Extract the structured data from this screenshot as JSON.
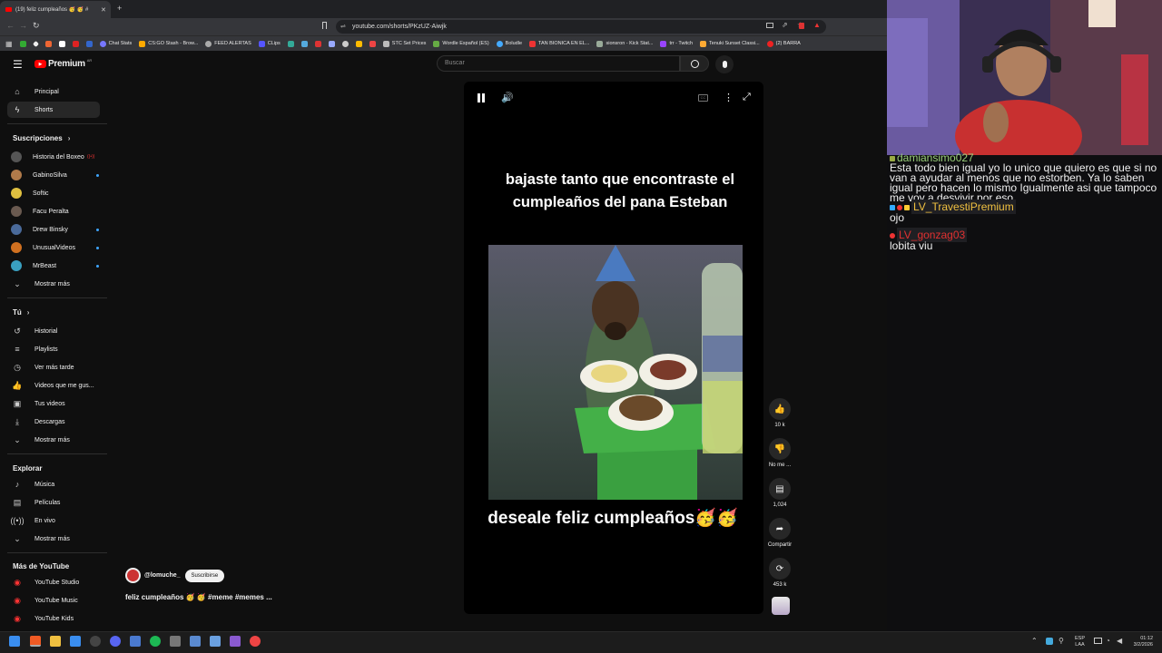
{
  "browser": {
    "tab_title": "(19) feliz cumpleaños 🥳 🥳 #",
    "url": "youtube.com/shorts/PKzUZ-Aiwjk",
    "bookmarks": [
      "Chat Stats",
      "CS:GO Stash - Brow...",
      "FEED ALERTAS",
      "CLips",
      "STC Set Prices",
      "Wordle Español (ES)",
      "Boludle",
      "TAN BIONICA EN EL...",
      "sionsron - Kick Stat...",
      "trr - Twitch",
      "Tenuki Sunset Classi...",
      "(2) BARRA"
    ]
  },
  "youtube": {
    "logo_text": "Premium",
    "logo_region": "AR",
    "search_placeholder": "Buscar",
    "sidebar": {
      "main": [
        {
          "label": "Principal",
          "icon": "home-icon"
        },
        {
          "label": "Shorts",
          "icon": "shorts-icon"
        }
      ],
      "subscriptions_title": "Suscripciones",
      "subscriptions": [
        {
          "label": "Historia del Boxeo",
          "color": "#555"
        },
        {
          "label": "GabinoSilva",
          "color": "#b07a4a"
        },
        {
          "label": "Softic",
          "color": "#e0c040"
        },
        {
          "label": "Facu Peralta",
          "color": "#6a5a50"
        },
        {
          "label": "Drew Binsky",
          "color": "#4a6a9a"
        },
        {
          "label": "UnusualVideos",
          "color": "#d07020"
        },
        {
          "label": "MrBeast",
          "color": "#3aa0c0"
        }
      ],
      "show_more": "Mostrar más",
      "you_title": "Tú",
      "you": [
        {
          "label": "Historial",
          "icon": "history-icon"
        },
        {
          "label": "Playlists",
          "icon": "playlist-icon"
        },
        {
          "label": "Ver más tarde",
          "icon": "watch-later-icon"
        },
        {
          "label": "Videos que me gus...",
          "icon": "like-icon"
        },
        {
          "label": "Tus videos",
          "icon": "your-videos-icon"
        },
        {
          "label": "Descargas",
          "icon": "download-icon"
        }
      ],
      "explore_title": "Explorar",
      "explore": [
        {
          "label": "Música",
          "icon": "music-icon"
        },
        {
          "label": "Películas",
          "icon": "movies-icon"
        },
        {
          "label": "En vivo",
          "icon": "live-icon"
        }
      ],
      "more_title": "Más de YouTube",
      "more": [
        {
          "label": "YouTube Studio"
        },
        {
          "label": "YouTube Music"
        },
        {
          "label": "YouTube Kids"
        }
      ]
    },
    "short": {
      "caption_top": "bajaste tanto que encontraste el cumpleaños del pana Esteban",
      "caption_bottom": "deseale feliz cumpleaños🥳🥳",
      "channel": "@lomuche_",
      "subscribe": "Suscribirse",
      "title": "feliz cumpleaños 🥳 🥳 #meme #memes ...",
      "likes": "10 k",
      "dislike": "No me ...",
      "comments": "1,024",
      "share": "Compartir",
      "remix": "453 k"
    }
  },
  "chat": {
    "messages": [
      {
        "user": "damiansimo027",
        "text": "",
        "color": "#9ad07a"
      },
      {
        "user": "",
        "text": "Esta todo bien igual yo lo unico que quiero es que si no van a ayudar al menos que no estorben. Ya lo saben igual pero hacen lo mismo Igualmente asi que tampoco me voy a desvivir por eso",
        "color": "#efeff1"
      },
      {
        "user": "LV_TravestiPremium",
        "text": "ojo",
        "color": "#f0c040"
      },
      {
        "user": "LV_gonzag03",
        "text": "lobita viu",
        "color": "#e03030"
      }
    ]
  },
  "taskbar": {
    "lang": "ESP",
    "lang2": "LAA",
    "time": "01:12",
    "date": "3/2/2026"
  }
}
